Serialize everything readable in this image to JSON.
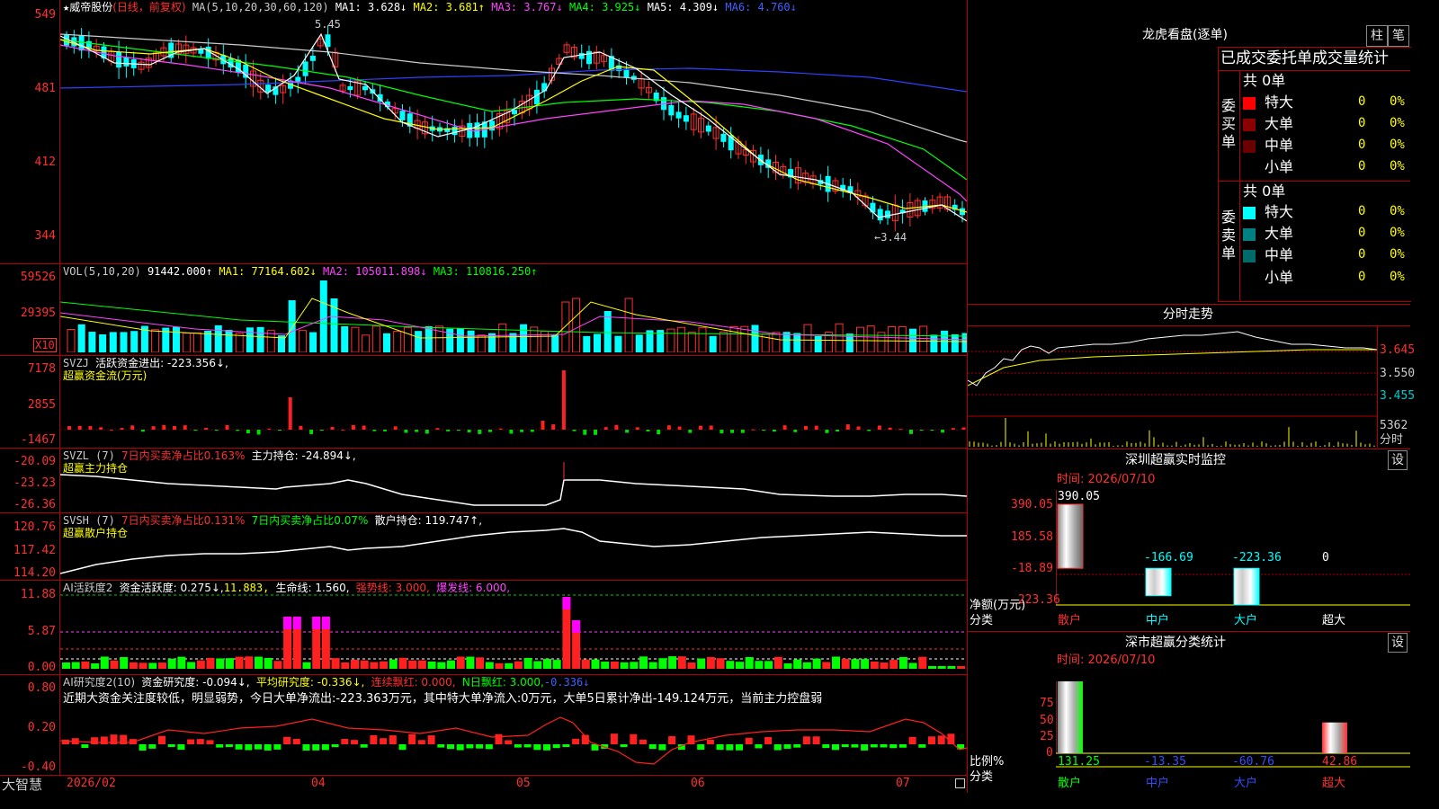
{
  "stock": {
    "star": "★",
    "name": "威帝股份",
    "period": "(日线，前复权)",
    "ma_label": "MA(5,10,20,30,60,120)",
    "ma1": "MA1: 3.628↓",
    "ma2": "MA2: 3.681↑",
    "ma3": "MA3: 3.767↓",
    "ma4": "MA4: 3.925↓",
    "ma5": "MA5: 4.309↓",
    "ma6": "MA6: 4.760↓",
    "high_mark": "5.45",
    "low_mark": "←3.44",
    "y_ticks": [
      "549",
      "481",
      "412",
      "344"
    ],
    "colors": {
      "ma1": "#ffffff",
      "ma2": "#ffff00",
      "ma3": "#ff44ff",
      "ma4": "#00ff00",
      "ma5": "#ffffff",
      "ma6": "#4040ff",
      "up": "#ff3030",
      "down": "#00ffff"
    }
  },
  "vol": {
    "label": "VOL(5,10,20)",
    "value": "91442.000↑",
    "ma1": "MA1: 77164.602↓",
    "ma2": "MA2: 105011.898↓",
    "ma3": "MA3: 110816.250↑",
    "y_ticks": [
      "59526",
      "29395"
    ],
    "unit": "X10"
  },
  "svzj": {
    "label": "SVZJ",
    "line1": "活跃资金进出: -223.356↓,",
    "line2": "超赢资金流(万元)",
    "y_ticks": [
      "7178",
      "2855",
      "-1467"
    ]
  },
  "svzl": {
    "label": "SVZL (7)",
    "pct": "7日内买卖净占比0.163%",
    "hold": "主力持仓: -24.894↓,",
    "line2": "超赢主力持仓",
    "y_ticks": [
      "-20.09",
      "-23.23",
      "-26.36"
    ]
  },
  "svsh": {
    "label": "SVSH (7)",
    "pct1": "7日内买卖净占比0.131%",
    "pct2": "7日内买卖净占比0.07%",
    "hold": "散户持仓: 119.747↑,",
    "line2": "超赢散户持仓",
    "y_ticks": [
      "120.76",
      "117.42",
      "114.20"
    ]
  },
  "ai1": {
    "label": "AI活跃度2",
    "act": "资金活跃度: 0.275↓,",
    "v2": "11.883,",
    "life": "生命线: 1.560,",
    "strong": "强势线: 3.000,",
    "burst": "爆发线: 6.000,",
    "y_ticks": [
      "11.88",
      "5.87",
      "0.00"
    ]
  },
  "ai2": {
    "label": "AI研究度2(10)",
    "res": "资金研究度: -0.094↓,",
    "avg": "平均研究度: -0.336↓,",
    "red": "连续飘红: 0.000,",
    "nred": "N日飘红: 3.000,",
    "v": "-0.336↓",
    "comment": "近期大资金关注度较低，明显弱势，今日大单净流出:-223.363万元，其中特大单净流入:0万元，大单5日累计净出-149.124万元，当前主力控盘弱",
    "y_ticks": [
      "0.80",
      "0.20",
      "-0.40"
    ]
  },
  "xaxis": {
    "brand": "大智慧",
    "labels": [
      "2026/02",
      "04",
      "05",
      "06",
      "07"
    ]
  },
  "right": {
    "title": "龙虎看盘(逐单)",
    "tab_bar": "柱",
    "tab_pen": "笔",
    "header": "已成交委托单成交量统计",
    "buy_group": "委买单",
    "sell_group": "委卖单",
    "buy_total": "共 0单",
    "sell_total": "共 0单",
    "buy_rows": [
      {
        "label": "特大",
        "count": "0",
        "pct": "0%",
        "color": "#ff0000"
      },
      {
        "label": "大单",
        "count": "0",
        "pct": "0%",
        "color": "#8b0000"
      },
      {
        "label": "中单",
        "count": "0",
        "pct": "0%",
        "color": "#6b0000"
      },
      {
        "label": "小单",
        "count": "0",
        "pct": "0%",
        "color": "#000000"
      }
    ],
    "sell_rows": [
      {
        "label": "特大",
        "count": "0",
        "pct": "0%",
        "color": "#00ffff"
      },
      {
        "label": "大单",
        "count": "0",
        "pct": "0%",
        "color": "#008080"
      },
      {
        "label": "中单",
        "count": "0",
        "pct": "0%",
        "color": "#006b6b"
      },
      {
        "label": "小单",
        "count": "0",
        "pct": "0%",
        "color": "#000000"
      }
    ],
    "intraday_title": "分时走势",
    "intraday_ticks": [
      "3.645",
      "3.550",
      "3.455"
    ],
    "intraday_vol": "5362",
    "intraday_unit": "分时",
    "monitor_title": "深圳超赢实时监控",
    "monitor_set": "设",
    "monitor_time": "时间: 2026/07/10",
    "monitor_ticks": [
      "390.05",
      "185.58",
      "-18.89",
      "-223.36"
    ],
    "monitor_values": [
      "390.05",
      "-166.69",
      "-223.36",
      "0"
    ],
    "monitor_ylabel": "净额(万元)",
    "monitor_xlabel": "分类",
    "categories": [
      "散户",
      "中户",
      "大户",
      "超大"
    ],
    "stat_title": "深市超赢分类统计",
    "stat_set": "设",
    "stat_time": "时间: 2026/07/10",
    "stat_ticks": [
      "75",
      "50",
      "25",
      "0"
    ],
    "stat_values": [
      "131.25",
      "-13.35",
      "-60.76",
      "42.86"
    ],
    "stat_ylabel": "比例%",
    "stat_xlabel": "分类"
  },
  "chart_data": {
    "type": "bar",
    "title": "深圳超赢实时监控",
    "categories": [
      "散户",
      "中户",
      "大户",
      "超大"
    ],
    "values": [
      390.05,
      -166.69,
      -223.36,
      0
    ],
    "ylabel": "净额(万元)",
    "xlabel": "分类",
    "ylim": [
      -223.36,
      390.05
    ]
  }
}
